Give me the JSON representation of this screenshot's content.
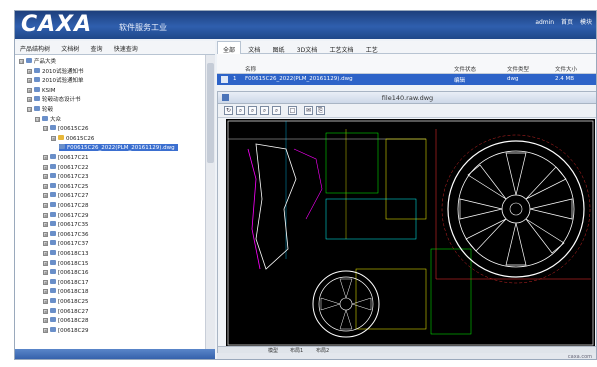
{
  "header": {
    "logo": "CAXA",
    "subtitle": "软件服务工业",
    "user": "admin",
    "links": [
      "首页",
      "模块"
    ]
  },
  "left_panel": {
    "tabs": [
      "产品结构树",
      "文档树",
      "查询",
      "快速查询"
    ],
    "tree": [
      {
        "label": "产品大类",
        "expander": "⊟",
        "icon": "folder"
      },
      {
        "label": "2010试验通知书",
        "expander": "⊞",
        "icon": "folder"
      },
      {
        "label": "2010试验通知单",
        "expander": "⊞",
        "icon": "folder"
      },
      {
        "label": "KSIM",
        "expander": "⊞",
        "icon": "folder"
      },
      {
        "label": "轮毂动态设计书",
        "expander": "⊞",
        "icon": "folder"
      },
      {
        "label": "轮毂",
        "expander": "⊟",
        "icon": "folder"
      },
      {
        "label": "大众",
        "expander": "⊟",
        "icon": "folder"
      },
      {
        "label": "[00615C26",
        "expander": "⊟",
        "icon": "part"
      },
      {
        "label": "00615C26",
        "expander": "⊞",
        "icon": "part-yellow"
      },
      {
        "label": "F00615C26_2022(PLM_20161129).dwg",
        "expander": "",
        "icon": "file",
        "selected": true
      },
      {
        "label": "[00617C21",
        "expander": "⊞",
        "icon": "part"
      },
      {
        "label": "[00617C22",
        "expander": "⊞",
        "icon": "part"
      },
      {
        "label": "[00617C23",
        "expander": "⊞",
        "icon": "part"
      },
      {
        "label": "[00617C25",
        "expander": "⊞",
        "icon": "part"
      },
      {
        "label": "[00617C27",
        "expander": "⊞",
        "icon": "part"
      },
      {
        "label": "[00617C28",
        "expander": "⊞",
        "icon": "part"
      },
      {
        "label": "[00617C29",
        "expander": "⊞",
        "icon": "part"
      },
      {
        "label": "[00617C35",
        "expander": "⊞",
        "icon": "part"
      },
      {
        "label": "[00617C36",
        "expander": "⊞",
        "icon": "part"
      },
      {
        "label": "[00617C37",
        "expander": "⊞",
        "icon": "part"
      },
      {
        "label": "[00618C13",
        "expander": "⊞",
        "icon": "part"
      },
      {
        "label": "[00618C15",
        "expander": "⊞",
        "icon": "part"
      },
      {
        "label": "[00618C16",
        "expander": "⊞",
        "icon": "part"
      },
      {
        "label": "[00618C17",
        "expander": "⊞",
        "icon": "part"
      },
      {
        "label": "[00618C18",
        "expander": "⊞",
        "icon": "part"
      },
      {
        "label": "[00618C25",
        "expander": "⊞",
        "icon": "part"
      },
      {
        "label": "[00618C27",
        "expander": "⊞",
        "icon": "part"
      },
      {
        "label": "[00618C28",
        "expander": "⊞",
        "icon": "part"
      },
      {
        "label": "[00618C29",
        "expander": "⊞",
        "icon": "part"
      }
    ]
  },
  "right_panel": {
    "tabs": [
      "全部",
      "文档",
      "图纸",
      "3D文档",
      "工艺文档",
      "工艺"
    ],
    "columns": [
      "名称",
      "文件状态",
      "文件类型",
      "文件大小"
    ],
    "row": {
      "index": "1",
      "name": "F00615C26_2022(PLM_20161129).dwg",
      "status": "编辑",
      "type": "dwg",
      "size": "2.4 MB"
    }
  },
  "viewer": {
    "title": "file140.raw.dwg",
    "tools": [
      "↻",
      "⌕",
      "⌕",
      "⌕",
      "⌕",
      "□",
      "✉",
      "⎘"
    ],
    "bottom_tabs": [
      "模型",
      "布局1",
      "布局2"
    ]
  },
  "status_bar": {
    "text": "caxa.com"
  },
  "colors": {
    "header": "#2f5fae",
    "selection": "#2d63c8",
    "drawing_bg": "#000000"
  }
}
